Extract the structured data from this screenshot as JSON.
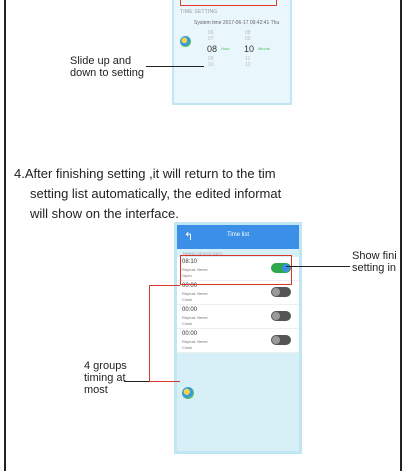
{
  "top_phone": {
    "section_heading": "TIME SETTING",
    "system_time": "System time 2017-06-17 09:42:41 Thu",
    "hour_above": [
      "06",
      "07"
    ],
    "hour_selected": "08",
    "hour_unit": "Hour",
    "hour_below": [
      "09",
      "10"
    ],
    "minute_above": [
      "08",
      "09"
    ],
    "minute_selected": "10",
    "minute_unit": "Minute",
    "minute_below": [
      "11",
      "12"
    ]
  },
  "annotations": {
    "slide_line1": "Slide up and",
    "slide_line2": "down to setting",
    "show_line1": "Show fini",
    "show_line2": "setting in",
    "groups_line1": "4 groups",
    "groups_line2": "timing at",
    "groups_line3": "most"
  },
  "body": {
    "line1": "4.After finishing setting ,it will return to the tim",
    "line2": "setting list automatically, the edited informat",
    "line3": "will show on the interface."
  },
  "bottom_phone": {
    "back_glyph": "↰",
    "title": "Time list",
    "section_heading": "TIMING DEVICE INFO",
    "rows": [
      {
        "time": "08:10",
        "repeat": "Repeat:  Never",
        "state": "Open"
      },
      {
        "time": "00:00",
        "repeat": "Repeat:  Never",
        "state": "Close"
      },
      {
        "time": "00:00",
        "repeat": "Repeat:  Never",
        "state": "Close"
      },
      {
        "time": "00:00",
        "repeat": "Repeat:  Never",
        "state": "Close"
      }
    ],
    "toggle_off_mark": "O"
  },
  "colors": {
    "header_blue": "#3b8fe6",
    "toggle_on": "#2ea84a",
    "annotation_red": "#d9362b"
  }
}
